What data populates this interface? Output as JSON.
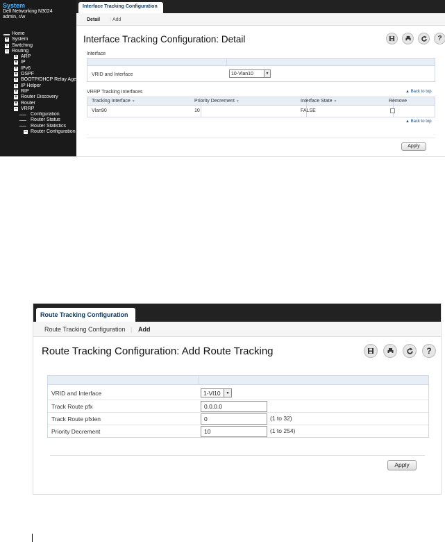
{
  "shot1": {
    "nav": {
      "system_title": "System",
      "device": "Dell Networking N3024",
      "user": "admin, r/w",
      "items": [
        {
          "label": "Home",
          "level": 0,
          "marker": "none"
        },
        {
          "label": "System",
          "level": 0,
          "marker": "+"
        },
        {
          "label": "Switching",
          "level": 0,
          "marker": "+"
        },
        {
          "label": "Routing",
          "level": 0,
          "marker": "-"
        },
        {
          "label": "ARP",
          "level": 1,
          "marker": "+"
        },
        {
          "label": "IP",
          "level": 1,
          "marker": "+"
        },
        {
          "label": "IPv6",
          "level": 1,
          "marker": "+"
        },
        {
          "label": "OSPF",
          "level": 1,
          "marker": "+"
        },
        {
          "label": "BOOTP/DHCP Relay Agent",
          "level": 1,
          "marker": "+"
        },
        {
          "label": "IP Helper",
          "level": 1,
          "marker": "+"
        },
        {
          "label": "RIP",
          "level": 1,
          "marker": "+"
        },
        {
          "label": "Router Discovery",
          "level": 1,
          "marker": "+"
        },
        {
          "label": "Router",
          "level": 1,
          "marker": "+"
        },
        {
          "label": "VRRP",
          "level": 1,
          "marker": "-"
        },
        {
          "label": "Configuration",
          "level": 2,
          "marker": "none"
        },
        {
          "label": "Router Status",
          "level": 2,
          "marker": "none"
        },
        {
          "label": "Router Statistics",
          "level": 2,
          "marker": "none"
        },
        {
          "label": "Router Configuration",
          "level": 2,
          "marker": "-"
        }
      ]
    },
    "tab_title": "Interface Tracking Configuration",
    "subtabs": {
      "detail": "Detail",
      "add": "Add"
    },
    "page_title": "Interface Tracking Configuration: Detail",
    "section_interface": "Interface",
    "vrid_label": "VRID and Interface",
    "vrid_value": "10-Vlan10",
    "section_vrrp": "VRRP Tracking Interfaces",
    "back_to_top": "Back to top",
    "columns": [
      "Tracking Interface",
      "Priority Decrement",
      "Interface State",
      "Remove"
    ],
    "rows": [
      {
        "interface": "Vlan90",
        "priority": "10",
        "state": "FALSE"
      }
    ],
    "apply": "Apply"
  },
  "shot2": {
    "tab_title": "Route Tracking Configuration",
    "subtabs": {
      "config": "Route Tracking Configuration",
      "add": "Add"
    },
    "page_title": "Route Tracking Configuration: Add Route Tracking",
    "fields": {
      "vrid": {
        "label": "VRID and Interface",
        "value": "1-Vl10"
      },
      "pfx": {
        "label": "Track Route pfx",
        "value": "0.0.0.0"
      },
      "pfxlen": {
        "label": "Track Route pfxlen",
        "value": "0",
        "range": "(1 to 32)"
      },
      "priority": {
        "label": "Priority Decrement",
        "value": "10",
        "range": "(1 to 254)"
      }
    },
    "apply": "Apply"
  },
  "colors": {
    "nav_bg": "#1a1a1a",
    "tabbar_bg": "#222222",
    "title_blue": "#0d3b66",
    "link_blue": "#1a4c80",
    "header_strip": "#e8eef5"
  }
}
